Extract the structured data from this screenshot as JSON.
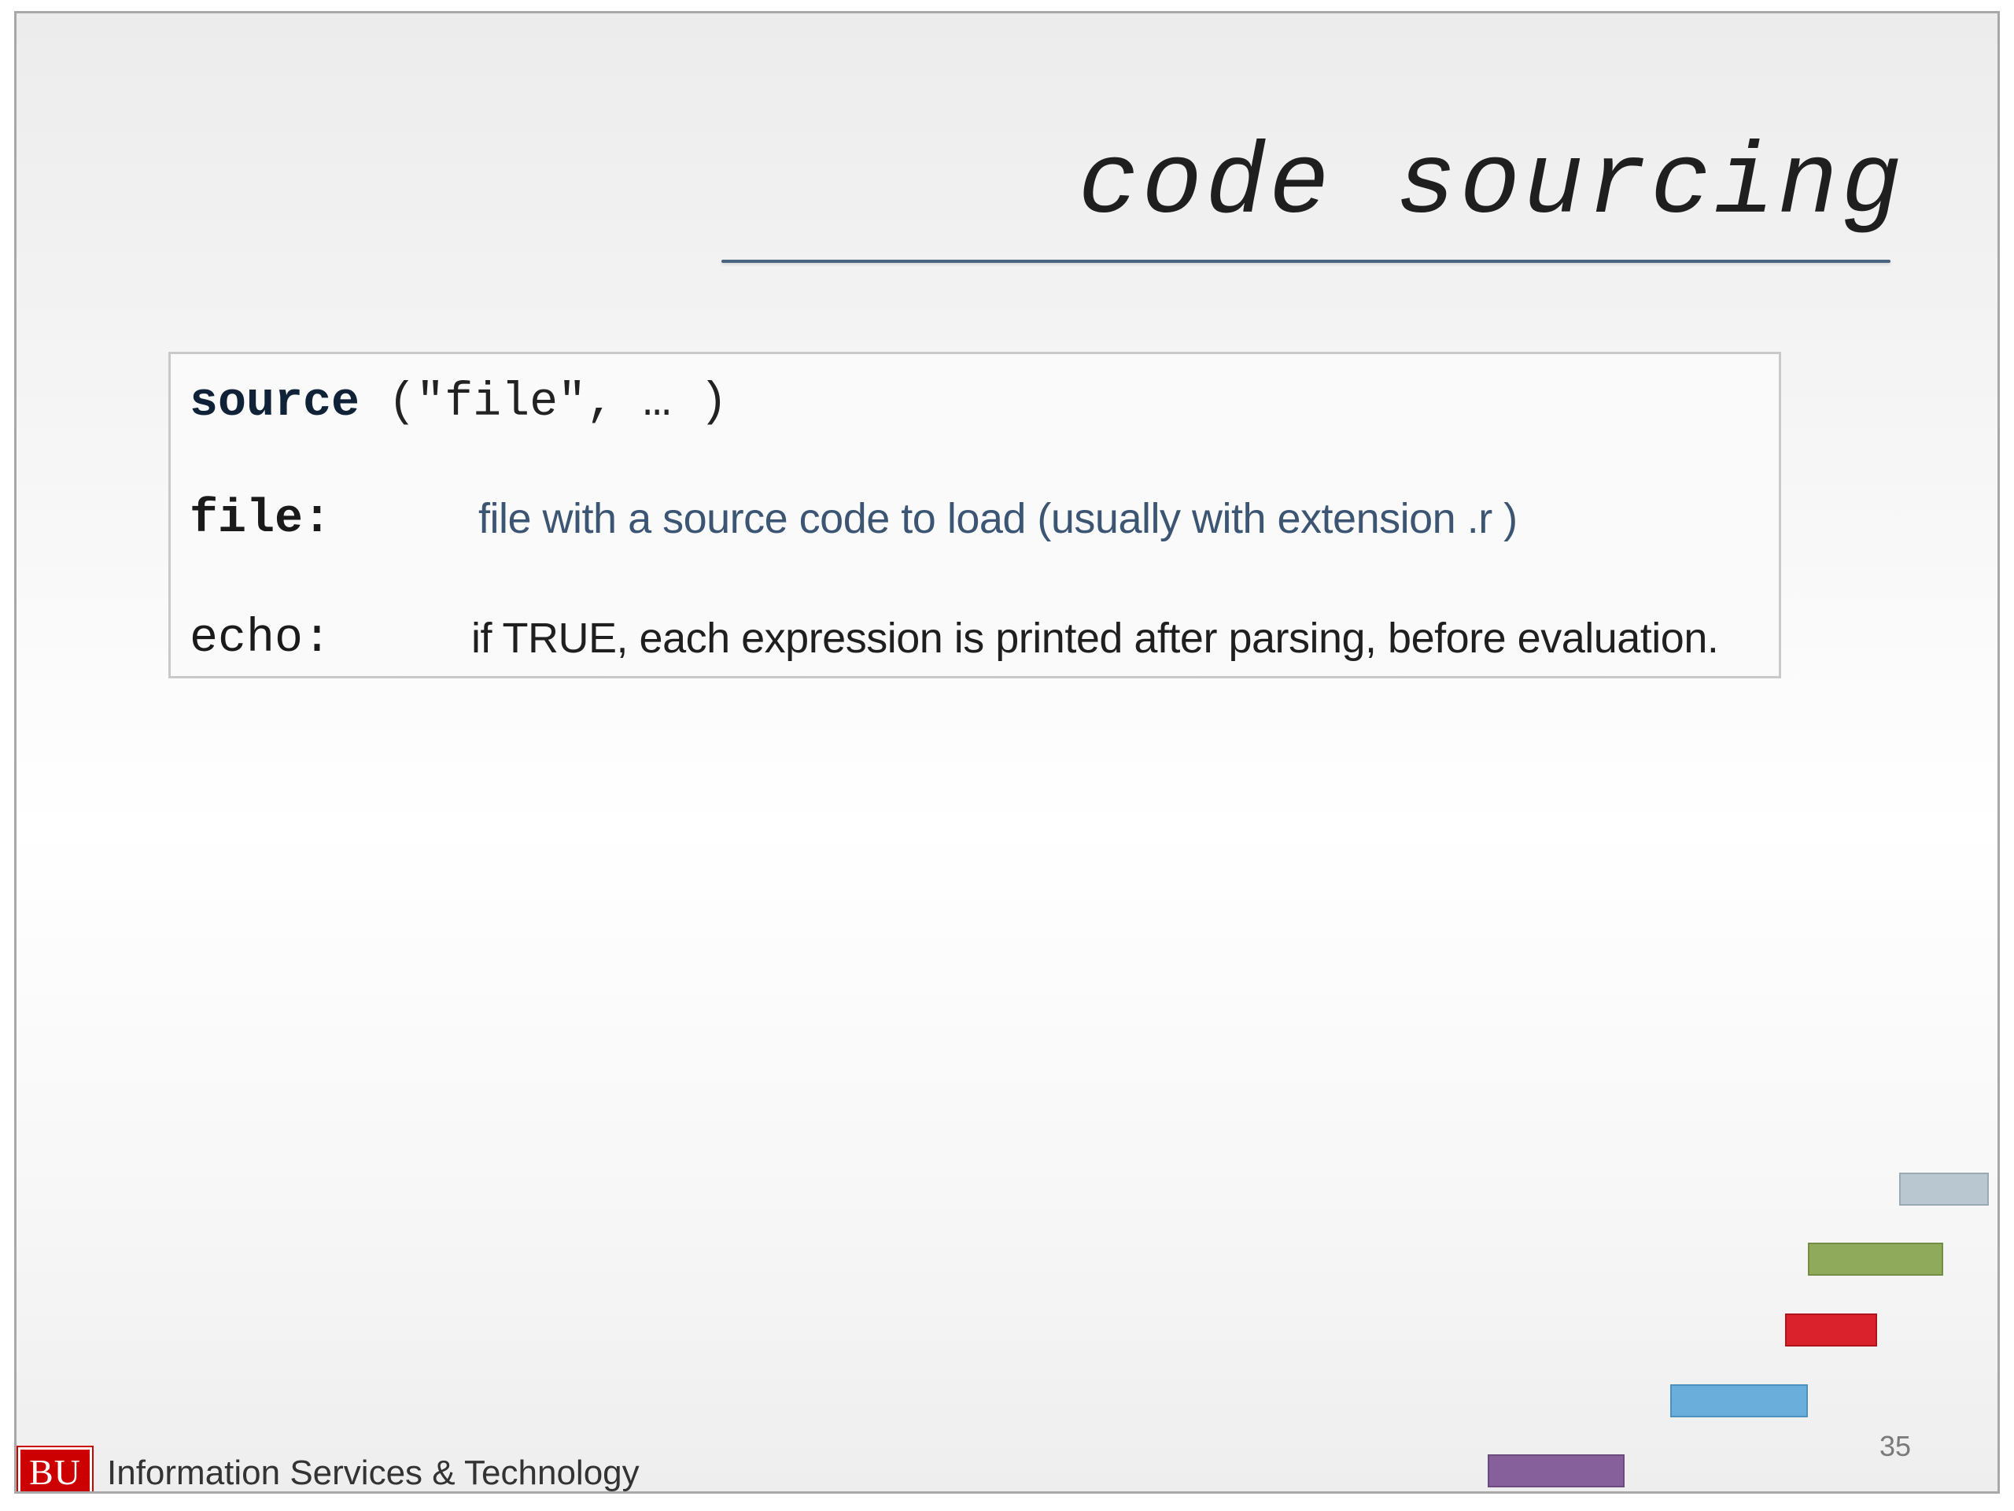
{
  "slide": {
    "title": "code sourcing",
    "code": {
      "function_name": "source",
      "arguments": " (\"file\", … )"
    },
    "params": [
      {
        "name": "file:",
        "description": "file with a source code to load (usually with extension .r )"
      },
      {
        "name": "echo:",
        "description": "if TRUE, each expression is printed after parsing, before evaluation."
      }
    ],
    "page_number": "35"
  },
  "footer": {
    "logo_text": "BU",
    "organization": "Information Services & Technology"
  },
  "decoration": {
    "bar_colors": [
      "#b8c7d0",
      "#8faa5b",
      "#d9222c",
      "#6aaedc",
      "#86609a"
    ]
  }
}
